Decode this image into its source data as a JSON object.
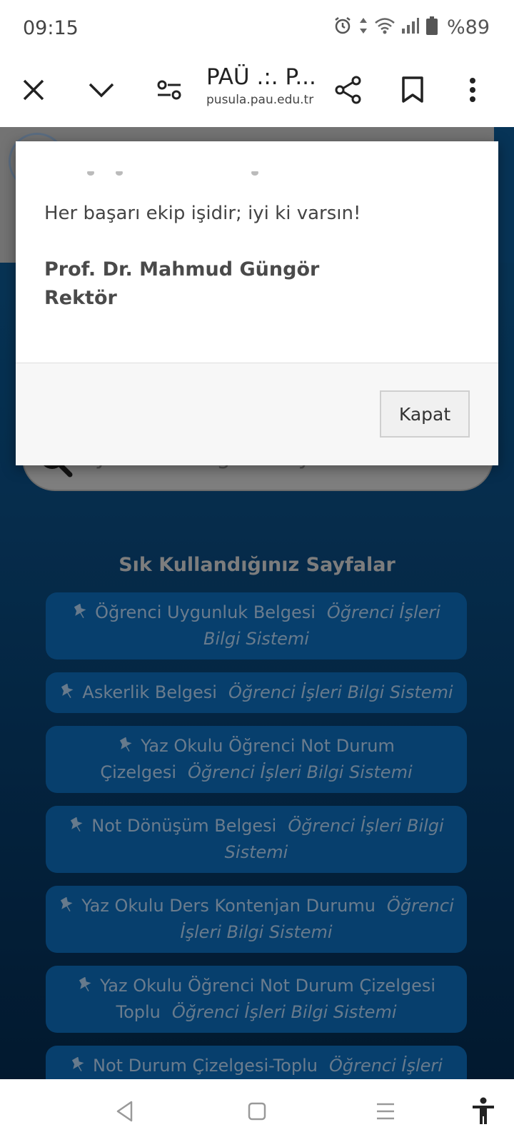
{
  "status_bar": {
    "time": "09:15",
    "battery": "%89"
  },
  "browser": {
    "title": "PAÜ .:. P...",
    "url": "pusula.pau.edu.tr"
  },
  "modal": {
    "message": "Her başarı ekip işidir; iyi ki varsın!",
    "signature_name": "Prof. Dr. Mahmud Güngör",
    "signature_title": "Rektör",
    "close_label": "Kapat"
  },
  "search": {
    "placeholder": "yetkili olduğum sayfalarda ara"
  },
  "frequent_pages": {
    "title": "Sık Kullandığınız Sayfalar",
    "items": [
      {
        "title": "Öğrenci Uygunluk Belgesi",
        "system": "Öğrenci İşleri Bilgi Sistemi"
      },
      {
        "title": "Askerlik Belgesi",
        "system": "Öğrenci İşleri Bilgi Sistemi"
      },
      {
        "title": "Yaz Okulu Öğrenci Not Durum Çizelgesi",
        "system": "Öğrenci İşleri Bilgi Sistemi"
      },
      {
        "title": "Not Dönüşüm Belgesi",
        "system": "Öğrenci İşleri Bilgi Sistemi"
      },
      {
        "title": "Yaz Okulu Ders Kontenjan Durumu",
        "system": "Öğrenci İşleri Bilgi Sistemi"
      },
      {
        "title": "Yaz Okulu Öğrenci Not Durum Çizelgesi Toplu",
        "system": "Öğrenci İşleri Bilgi Sistemi"
      },
      {
        "title": "Not Durum Çizelgesi-Toplu",
        "system": "Öğrenci İşleri Bilgi Sistemi"
      }
    ]
  }
}
